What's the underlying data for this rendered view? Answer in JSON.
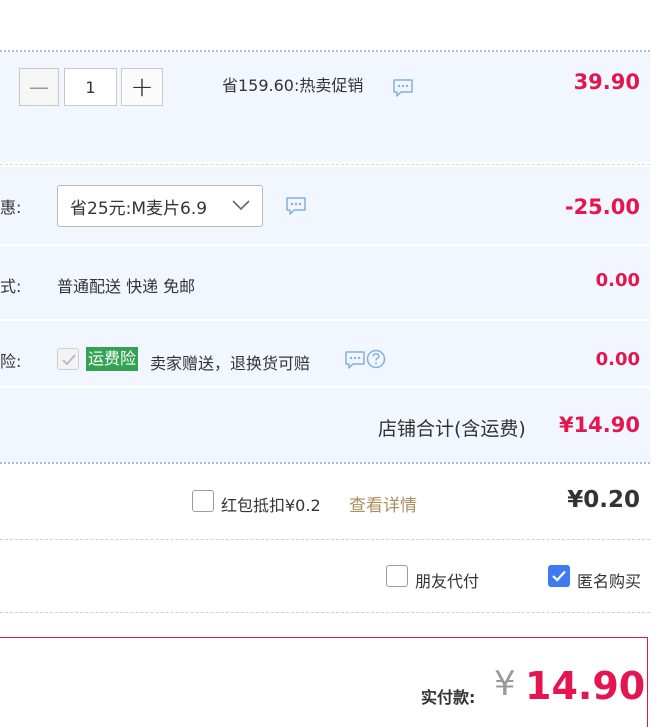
{
  "item": {
    "quantity": "1",
    "minus_symbol": "—",
    "plus_symbol": "+",
    "promo_text": "省159.60:热卖促销",
    "price": "39.90"
  },
  "discount": {
    "label": "惠:",
    "selected_option": "省25元:M麦片6.9",
    "amount": "-25.00"
  },
  "shipping": {
    "label": "式:",
    "method": "普通配送 快递 免邮",
    "amount": "0.00"
  },
  "insurance": {
    "label": "险:",
    "badge": "运费险",
    "description": "卖家赠送，退换货可赔",
    "amount": "0.00"
  },
  "store_total": {
    "label": "店铺合计(含运费)",
    "amount": "¥14.90"
  },
  "red_packet": {
    "label": "红包抵扣¥0.2",
    "details_link": "查看详情",
    "amount": "¥0.20"
  },
  "options": {
    "friend_pay": "朋友代付",
    "anonymous": "匿名购买"
  },
  "payment": {
    "label": "实付款:",
    "currency": "¥",
    "amount": "14.90"
  },
  "colors": {
    "accent_red": "#e4164f",
    "panel_blue": "#f2f7ff",
    "badge_green": "#31a352",
    "checkbox_blue": "#3e7af0",
    "link_tan": "#b08d5e"
  }
}
